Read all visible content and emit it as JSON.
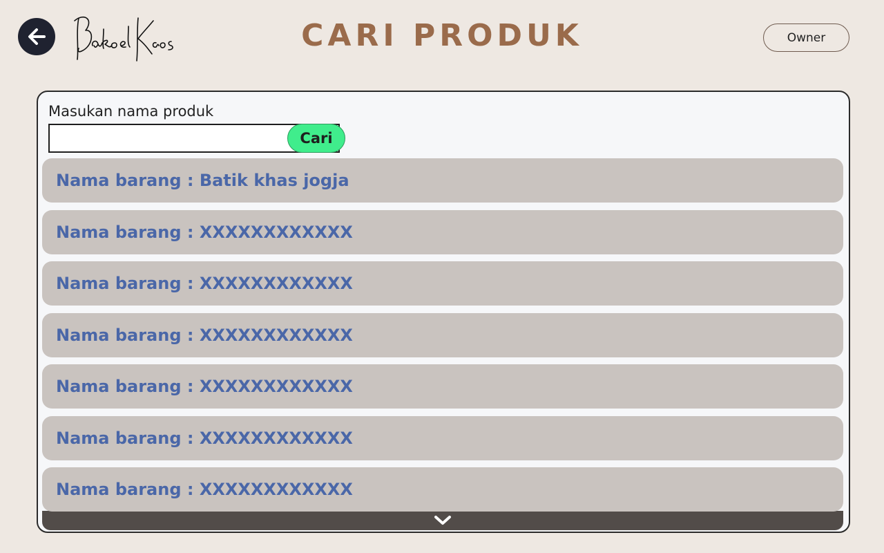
{
  "header": {
    "title": "CARI PRODUK",
    "owner_label": "Owner",
    "back_icon": "arrow-left-icon",
    "logo_text": "BakoelKaos"
  },
  "search": {
    "label": "Masukan nama produk",
    "value": "",
    "placeholder": "",
    "button_label": "Cari"
  },
  "results": [
    "Nama barang : Batik khas jogja",
    "Nama barang : XXXXXXXXXXXX",
    "Nama barang : XXXXXXXXXXXX",
    "Nama barang : XXXXXXXXXXXX",
    "Nama barang : XXXXXXXXXXXX",
    "Nama barang : XXXXXXXXXXXX",
    "Nama barang : XXXXXXXXXXXX"
  ],
  "scroll": {
    "icon": "chevron-down-icon"
  },
  "colors": {
    "background": "#eee8e2",
    "title": "#9a6b4b",
    "panel": "#f6f7f9",
    "result_bg": "#c9c3bf",
    "result_text": "#4a67a8",
    "search_button": "#40ed8c",
    "scroll_bar": "#524c49",
    "back_button": "#1f2230"
  }
}
